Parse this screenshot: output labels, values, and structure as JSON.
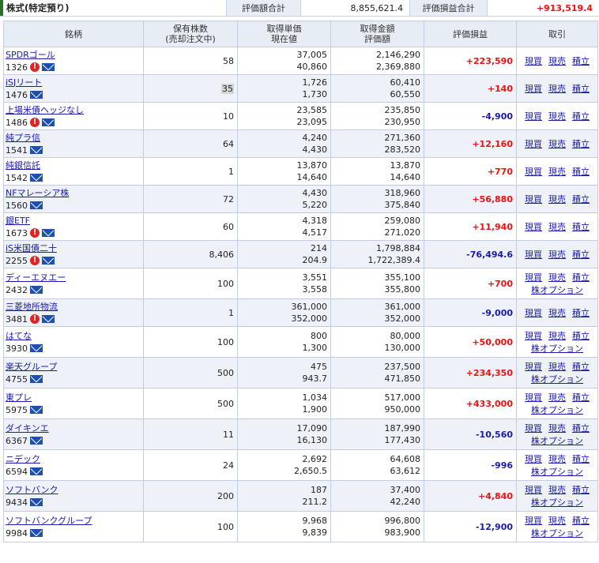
{
  "section_title": "株式(特定預り)",
  "summary": {
    "eval_total_label": "評価額合計",
    "eval_total_value": "8,855,621.4",
    "pl_total_label": "評価損益合計",
    "pl_total_value": "+913,519.4"
  },
  "table": {
    "headers": {
      "name": "銘柄",
      "qty_line1": "保有株数",
      "qty_line2": "(売却注文中)",
      "price_line1": "取得単価",
      "price_line2": "現在値",
      "amount_line1": "取得金額",
      "amount_line2": "評価額",
      "pl": "評価損益",
      "trade": "取引"
    },
    "actions": {
      "buy": "現買",
      "sell": "現売",
      "accumulate": "積立",
      "option": "株オプション"
    },
    "rows": [
      {
        "name": "SPDRゴール",
        "code": "1326",
        "alert": true,
        "qty": "58",
        "cost": "37,005",
        "price": "40,860",
        "cost_amount": "2,146,290",
        "value": "2,369,880",
        "pl": "+223,590",
        "pl_sign": "pos",
        "option": false,
        "hl": false
      },
      {
        "name": "iSJリート",
        "code": "1476",
        "alert": false,
        "qty": "35",
        "cost": "1,726",
        "price": "1,730",
        "cost_amount": "60,410",
        "value": "60,550",
        "pl": "+140",
        "pl_sign": "pos",
        "option": false,
        "hl": true
      },
      {
        "name": "上場米債ヘッジなし",
        "code": "1486",
        "alert": true,
        "qty": "10",
        "cost": "23,585",
        "price": "23,095",
        "cost_amount": "235,850",
        "value": "230,950",
        "pl": "-4,900",
        "pl_sign": "neg",
        "option": false,
        "hl": false
      },
      {
        "name": "純プラ信",
        "code": "1541",
        "alert": false,
        "qty": "64",
        "cost": "4,240",
        "price": "4,430",
        "cost_amount": "271,360",
        "value": "283,520",
        "pl": "+12,160",
        "pl_sign": "pos",
        "option": false,
        "hl": false
      },
      {
        "name": "純銀信託",
        "code": "1542",
        "alert": false,
        "qty": "1",
        "cost": "13,870",
        "price": "14,640",
        "cost_amount": "13,870",
        "value": "14,640",
        "pl": "+770",
        "pl_sign": "pos",
        "option": false,
        "hl": false
      },
      {
        "name": "NFマレーシア株",
        "code": "1560",
        "alert": false,
        "qty": "72",
        "cost": "4,430",
        "price": "5,220",
        "cost_amount": "318,960",
        "value": "375,840",
        "pl": "+56,880",
        "pl_sign": "pos",
        "option": false,
        "hl": false
      },
      {
        "name": "銀ETF",
        "code": "1673",
        "alert": true,
        "qty": "60",
        "cost": "4,318",
        "price": "4,517",
        "cost_amount": "259,080",
        "value": "271,020",
        "pl": "+11,940",
        "pl_sign": "pos",
        "option": false,
        "hl": false
      },
      {
        "name": "iS米国債二十",
        "code": "2255",
        "alert": true,
        "qty": "8,406",
        "cost": "214",
        "price": "204.9",
        "cost_amount": "1,798,884",
        "value": "1,722,389.4",
        "pl": "-76,494.6",
        "pl_sign": "neg",
        "option": false,
        "hl": false
      },
      {
        "name": "ディーエヌエー",
        "code": "2432",
        "alert": false,
        "qty": "100",
        "cost": "3,551",
        "price": "3,558",
        "cost_amount": "355,100",
        "value": "355,800",
        "pl": "+700",
        "pl_sign": "pos",
        "option": true,
        "hl": false
      },
      {
        "name": "三菱地所物流",
        "code": "3481",
        "alert": true,
        "qty": "1",
        "cost": "361,000",
        "price": "352,000",
        "cost_amount": "361,000",
        "value": "352,000",
        "pl": "-9,000",
        "pl_sign": "neg",
        "option": false,
        "hl": false
      },
      {
        "name": "はてな",
        "code": "3930",
        "alert": false,
        "qty": "100",
        "cost": "800",
        "price": "1,300",
        "cost_amount": "80,000",
        "value": "130,000",
        "pl": "+50,000",
        "pl_sign": "pos",
        "option": true,
        "hl": false
      },
      {
        "name": "楽天グループ",
        "code": "4755",
        "alert": false,
        "qty": "500",
        "cost": "475",
        "price": "943.7",
        "cost_amount": "237,500",
        "value": "471,850",
        "pl": "+234,350",
        "pl_sign": "pos",
        "option": true,
        "hl": false
      },
      {
        "name": "東プレ",
        "code": "5975",
        "alert": false,
        "qty": "500",
        "cost": "1,034",
        "price": "1,900",
        "cost_amount": "517,000",
        "value": "950,000",
        "pl": "+433,000",
        "pl_sign": "pos",
        "option": true,
        "hl": false
      },
      {
        "name": "ダイキンエ",
        "code": "6367",
        "alert": false,
        "qty": "11",
        "cost": "17,090",
        "price": "16,130",
        "cost_amount": "187,990",
        "value": "177,430",
        "pl": "-10,560",
        "pl_sign": "neg",
        "option": true,
        "hl": false
      },
      {
        "name": "ニデック",
        "code": "6594",
        "alert": false,
        "qty": "24",
        "cost": "2,692",
        "price": "2,650.5",
        "cost_amount": "64,608",
        "value": "63,612",
        "pl": "-996",
        "pl_sign": "neg",
        "option": true,
        "hl": false
      },
      {
        "name": "ソフトバンク",
        "code": "9434",
        "alert": false,
        "qty": "200",
        "cost": "187",
        "price": "211.2",
        "cost_amount": "37,400",
        "value": "42,240",
        "pl": "+4,840",
        "pl_sign": "pos",
        "option": true,
        "hl": false
      },
      {
        "name": "ソフトバンクグループ",
        "code": "9984",
        "alert": false,
        "qty": "100",
        "cost": "9,968",
        "price": "9,839",
        "cost_amount": "996,800",
        "value": "983,900",
        "pl": "-12,900",
        "pl_sign": "neg",
        "option": true,
        "hl": false
      }
    ]
  }
}
